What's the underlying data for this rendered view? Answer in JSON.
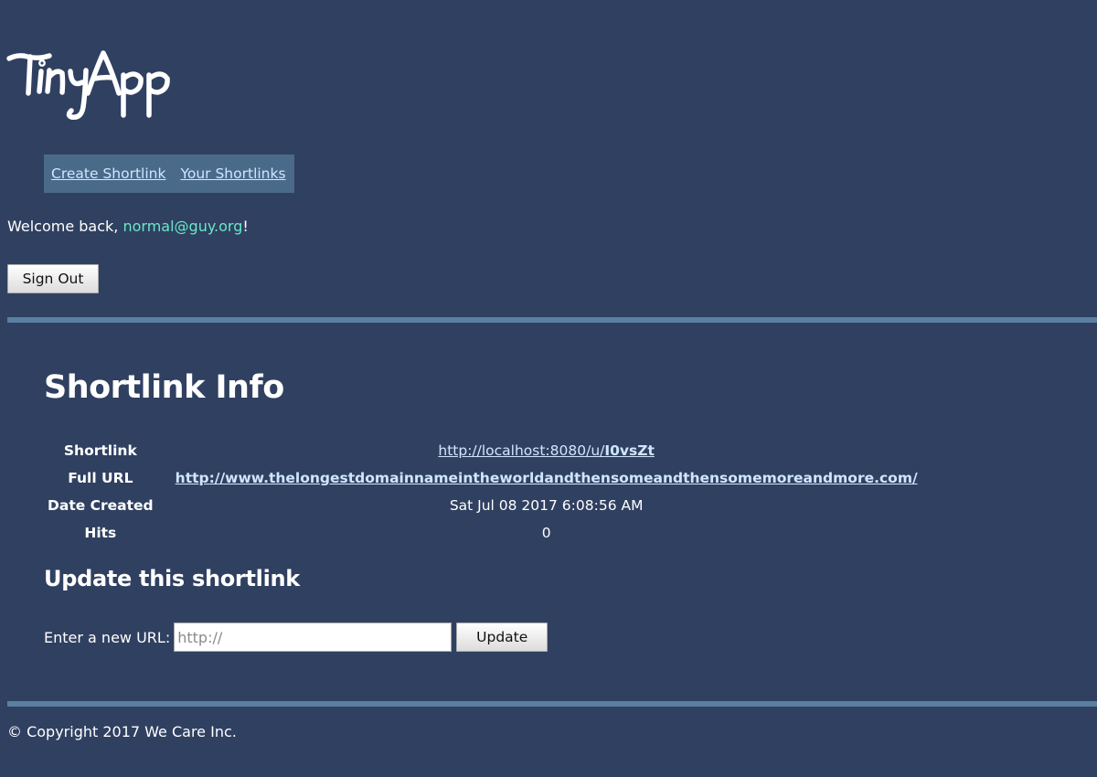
{
  "app": {
    "logo_text": "TinyApp"
  },
  "nav": {
    "items": [
      {
        "label": "Create Shortlink"
      },
      {
        "label": "Your Shortlinks"
      }
    ]
  },
  "welcome": {
    "prefix": "Welcome back, ",
    "email": "normal@guy.org",
    "suffix": "!"
  },
  "auth": {
    "signout_label": "Sign Out"
  },
  "info": {
    "heading": "Shortlink Info",
    "rows": {
      "shortlink": {
        "label": "Shortlink",
        "value_prefix": "http://localhost:8080/u/",
        "value_id": "I0vsZt"
      },
      "full_url": {
        "label": "Full URL",
        "value": "http://www.thelongestdomainnameintheworldandthensomeandthensomemoreandmore.com/"
      },
      "date_created": {
        "label": "Date Created",
        "value": "Sat Jul 08 2017 6:08:56 AM"
      },
      "hits": {
        "label": "Hits",
        "value": "0"
      }
    }
  },
  "update": {
    "heading": "Update this shortlink",
    "input_label": "Enter a new URL:",
    "input_placeholder": "http://",
    "button_label": "Update"
  },
  "footer": {
    "copyright": "© Copyright 2017 We Care Inc."
  },
  "colors": {
    "background": "#304061",
    "nav_background": "#4a6a8a",
    "rule": "#5a7fa3",
    "link": "#cfe6ff",
    "email": "#69e8c8"
  }
}
